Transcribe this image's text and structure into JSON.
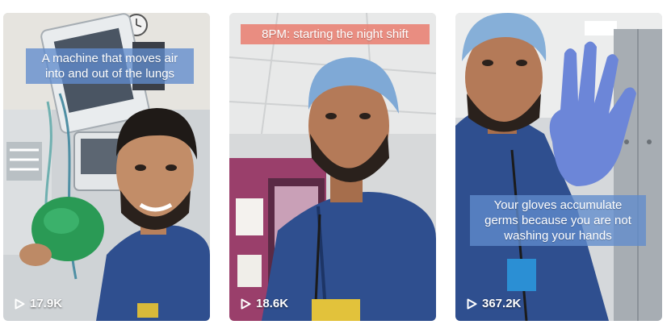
{
  "videos": [
    {
      "caption": "A machine that moves air into and out of the lungs",
      "views": "17.9K"
    },
    {
      "caption": "8PM: starting the night shift",
      "views": "18.6K"
    },
    {
      "caption": "Your gloves accumulate germs because you are not washing your hands",
      "views": "367.2K"
    }
  ],
  "icons": {
    "play": "play-icon"
  },
  "colors": {
    "caption_blue": "#608CCD",
    "caption_salmon": "#E88072",
    "scrubs": "#2F4F8F",
    "surgical_cap": "#7FA9D6",
    "glove": "#6C86D8"
  }
}
